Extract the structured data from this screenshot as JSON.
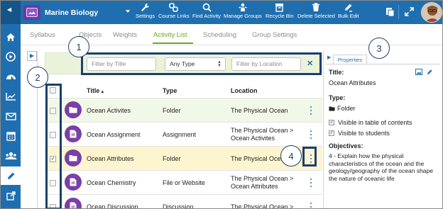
{
  "app": {
    "course_title": "Marine Biology",
    "toolbar": [
      {
        "label": "Settings",
        "icon": "wrench-icon"
      },
      {
        "label": "Course Links",
        "icon": "link-icon"
      },
      {
        "label": "Find Activity",
        "icon": "search-icon"
      },
      {
        "label": "Manage Groups",
        "icon": "group-icon"
      },
      {
        "label": "Recycle Bin",
        "icon": "recycle-bin-icon"
      },
      {
        "label": "Delete Selected",
        "icon": "trash-icon"
      },
      {
        "label": "Bulk Edit",
        "icon": "bulk-edit-icon"
      }
    ]
  },
  "rail": [
    "home-icon",
    "play-icon",
    "dashboard-icon",
    "chart-icon",
    "mail-icon",
    "calendar-icon",
    "users-icon",
    "pencil-icon",
    "external-link-icon"
  ],
  "tabs": [
    "Syllabus",
    "Objects",
    "Weights",
    "Activity List",
    "Scheduling",
    "Group Settings"
  ],
  "active_tab": "Activity List",
  "filters": {
    "title_placeholder": "Filter by Title",
    "type_value": "Any Type",
    "location_placeholder": "Filter by Location"
  },
  "list": {
    "columns": [
      "Title",
      "Type",
      "Location"
    ],
    "rows": [
      {
        "title": "Ocean Activites",
        "type": "Folder",
        "location": [
          "The Physical Ocean"
        ],
        "icon": "folder-icon",
        "checked": false
      },
      {
        "title": "Ocean Assignment",
        "type": "Assignment",
        "location": [
          "The Physical Ocean >",
          "Ocean Activites"
        ],
        "icon": "document-icon",
        "checked": false
      },
      {
        "title": "Ocean Attributes",
        "type": "Folder",
        "location": [
          "The Physical Ocean"
        ],
        "icon": "folder-icon",
        "checked": true
      },
      {
        "title": "Ocean Chemistry",
        "type": "File or Website",
        "location": [
          "The Physical Ocean >",
          "Ocean Attributes"
        ],
        "icon": "document-icon",
        "checked": false
      },
      {
        "title": "Ocean Discussion",
        "type": "Discussion",
        "location": [
          "The Physical Ocean >"
        ],
        "icon": "document-icon",
        "checked": false
      }
    ]
  },
  "properties": {
    "tab_label": "Properties",
    "title_label": "Title:",
    "title_value": "Ocean Attributes",
    "type_label": "Type:",
    "type_value": "Folder",
    "options": [
      {
        "label": "Visible in table of contents",
        "checked": true
      },
      {
        "label": "Visible to students",
        "checked": true
      }
    ],
    "objectives_label": "Objectives:",
    "objectives_value": "4 - Explain how the physical characteristics of the ocean and the geology/geography of the ocean shape the nature of oceanic life"
  },
  "callouts": [
    "1",
    "2",
    "3",
    "4"
  ],
  "colors": {
    "brand_blue": "#1f6fb0",
    "active_green": "#6aa820",
    "item_purple": "#7b3fa8",
    "callout_navy": "#1b3f6e",
    "selected_row": "#fcf5cf"
  }
}
